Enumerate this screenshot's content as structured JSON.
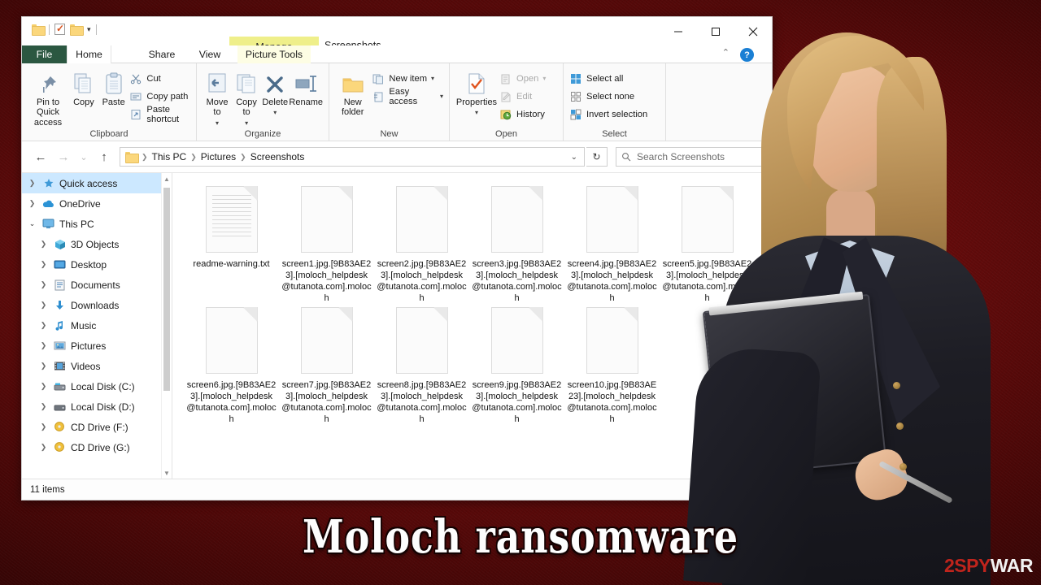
{
  "window": {
    "title": "Screenshots",
    "contextual_tab": "Manage",
    "quick_access": [
      "folder-icon",
      "properties-icon",
      "folder-icon",
      "customize-caret"
    ],
    "controls": {
      "minimize": "minimize-icon",
      "maximize": "maximize-icon",
      "close": "close-icon",
      "collapse_ribbon": "chevron-up-icon",
      "help": "?"
    },
    "tabs": [
      {
        "label": "File"
      },
      {
        "label": "Home"
      },
      {
        "label": "Share"
      },
      {
        "label": "View"
      },
      {
        "label": "Picture Tools"
      }
    ]
  },
  "ribbon": {
    "groups": [
      {
        "label": "Clipboard",
        "big": [
          {
            "label": "Pin to Quick access",
            "icon": "pin-icon"
          },
          {
            "label": "Copy",
            "icon": "copy-icon"
          },
          {
            "label": "Paste",
            "icon": "paste-icon"
          }
        ],
        "small": [
          {
            "label": "Cut",
            "icon": "scissors-icon"
          },
          {
            "label": "Copy path",
            "icon": "copy-path-icon"
          },
          {
            "label": "Paste shortcut",
            "icon": "paste-shortcut-icon"
          }
        ]
      },
      {
        "label": "Organize",
        "big": [
          {
            "label": "Move to",
            "icon": "move-to-icon",
            "caret": true
          },
          {
            "label": "Copy to",
            "icon": "copy-to-icon",
            "caret": true
          },
          {
            "label": "Delete",
            "icon": "delete-icon",
            "caret": true
          },
          {
            "label": "Rename",
            "icon": "rename-icon"
          }
        ],
        "small": []
      },
      {
        "label": "New",
        "big": [
          {
            "label": "New folder",
            "icon": "new-folder-icon"
          }
        ],
        "small": [
          {
            "label": "New item",
            "icon": "new-item-icon",
            "caret": true
          },
          {
            "label": "Easy access",
            "icon": "easy-access-icon",
            "caret": true
          }
        ]
      },
      {
        "label": "Open",
        "big": [
          {
            "label": "Properties",
            "icon": "properties-icon",
            "caret": true
          }
        ],
        "small": [
          {
            "label": "Open",
            "icon": "open-icon",
            "caret": true,
            "disabled": true
          },
          {
            "label": "Edit",
            "icon": "edit-icon",
            "disabled": true
          },
          {
            "label": "History",
            "icon": "history-icon"
          }
        ]
      },
      {
        "label": "Select",
        "big": [],
        "small": [
          {
            "label": "Select all",
            "icon": "select-all-icon"
          },
          {
            "label": "Select none",
            "icon": "select-none-icon"
          },
          {
            "label": "Invert selection",
            "icon": "invert-selection-icon"
          }
        ]
      }
    ]
  },
  "address_bar": {
    "back": "back-arrow-icon",
    "forward": "forward-arrow-icon",
    "recent": "chevron-down-icon",
    "up": "up-arrow-icon",
    "breadcrumbs": [
      "This PC",
      "Pictures",
      "Screenshots"
    ],
    "refresh": "refresh-icon",
    "search_placeholder": "Search Screenshots"
  },
  "sidebar": {
    "items": [
      {
        "label": "Quick access",
        "icon": "star-icon",
        "selected": true,
        "indent": 0,
        "expanded": false
      },
      {
        "label": "OneDrive",
        "icon": "cloud-icon",
        "selected": false,
        "indent": 0,
        "expanded": false
      },
      {
        "label": "This PC",
        "icon": "monitor-icon",
        "selected": false,
        "indent": 0,
        "expanded": true
      },
      {
        "label": "3D Objects",
        "icon": "3d-objects-icon",
        "selected": false,
        "indent": 1,
        "expanded": false
      },
      {
        "label": "Desktop",
        "icon": "desktop-icon",
        "selected": false,
        "indent": 1,
        "expanded": false
      },
      {
        "label": "Documents",
        "icon": "documents-icon",
        "selected": false,
        "indent": 1,
        "expanded": false
      },
      {
        "label": "Downloads",
        "icon": "downloads-icon",
        "selected": false,
        "indent": 1,
        "expanded": false
      },
      {
        "label": "Music",
        "icon": "music-icon",
        "selected": false,
        "indent": 1,
        "expanded": false
      },
      {
        "label": "Pictures",
        "icon": "pictures-icon",
        "selected": false,
        "indent": 1,
        "expanded": false
      },
      {
        "label": "Videos",
        "icon": "videos-icon",
        "selected": false,
        "indent": 1,
        "expanded": false
      },
      {
        "label": "Local Disk (C:)",
        "icon": "hard-disk-icon",
        "selected": false,
        "indent": 1,
        "expanded": false
      },
      {
        "label": "Local Disk (D:)",
        "icon": "hard-disk-icon",
        "selected": false,
        "indent": 1,
        "expanded": false
      },
      {
        "label": "CD Drive (F:)",
        "icon": "cd-drive-icon",
        "selected": false,
        "indent": 1,
        "expanded": false
      },
      {
        "label": "CD Drive (G:)",
        "icon": "cd-drive-icon",
        "selected": false,
        "indent": 1,
        "expanded": false
      }
    ]
  },
  "files": [
    {
      "name": "readme-warning.txt",
      "icon": "text-document-icon"
    },
    {
      "name": "screen1.jpg.[9B83AE23].[moloch_helpdesk@tutanota.com].moloch",
      "icon": "blank-document-icon"
    },
    {
      "name": "screen2.jpg.[9B83AE23].[moloch_helpdesk@tutanota.com].moloch",
      "icon": "blank-document-icon"
    },
    {
      "name": "screen3.jpg.[9B83AE23].[moloch_helpdesk@tutanota.com].moloch",
      "icon": "blank-document-icon"
    },
    {
      "name": "screen4.jpg.[9B83AE23].[moloch_helpdesk@tutanota.com].moloch",
      "icon": "blank-document-icon"
    },
    {
      "name": "screen5.jpg.[9B83AE23].[moloch_helpdesk@tutanota.com].moloch",
      "icon": "blank-document-icon"
    },
    {
      "name": "screen6.jpg.[9B83AE23].[moloch_helpdesk@tutanota.com].moloch",
      "icon": "blank-document-icon"
    },
    {
      "name": "screen7.jpg.[9B83AE23].[moloch_helpdesk@tutanota.com].moloch",
      "icon": "blank-document-icon"
    },
    {
      "name": "screen8.jpg.[9B83AE23].[moloch_helpdesk@tutanota.com].moloch",
      "icon": "blank-document-icon"
    },
    {
      "name": "screen9.jpg.[9B83AE23].[moloch_helpdesk@tutanota.com].moloch",
      "icon": "blank-document-icon"
    },
    {
      "name": "screen10.jpg.[9B83AE23].[moloch_helpdesk@tutanota.com].moloch",
      "icon": "blank-document-icon"
    }
  ],
  "status_bar": {
    "item_count": "11 items",
    "views": [
      {
        "name": "details-view-icon",
        "active": false
      },
      {
        "name": "large-icons-view-icon",
        "active": true
      }
    ]
  },
  "overlay": {
    "caption": "Moloch  ransomware",
    "watermark_primary": "2SPY",
    "watermark_secondary": "WAR",
    "accent_red": "#c0241c",
    "backdrop_red": "#6d0c0c"
  }
}
